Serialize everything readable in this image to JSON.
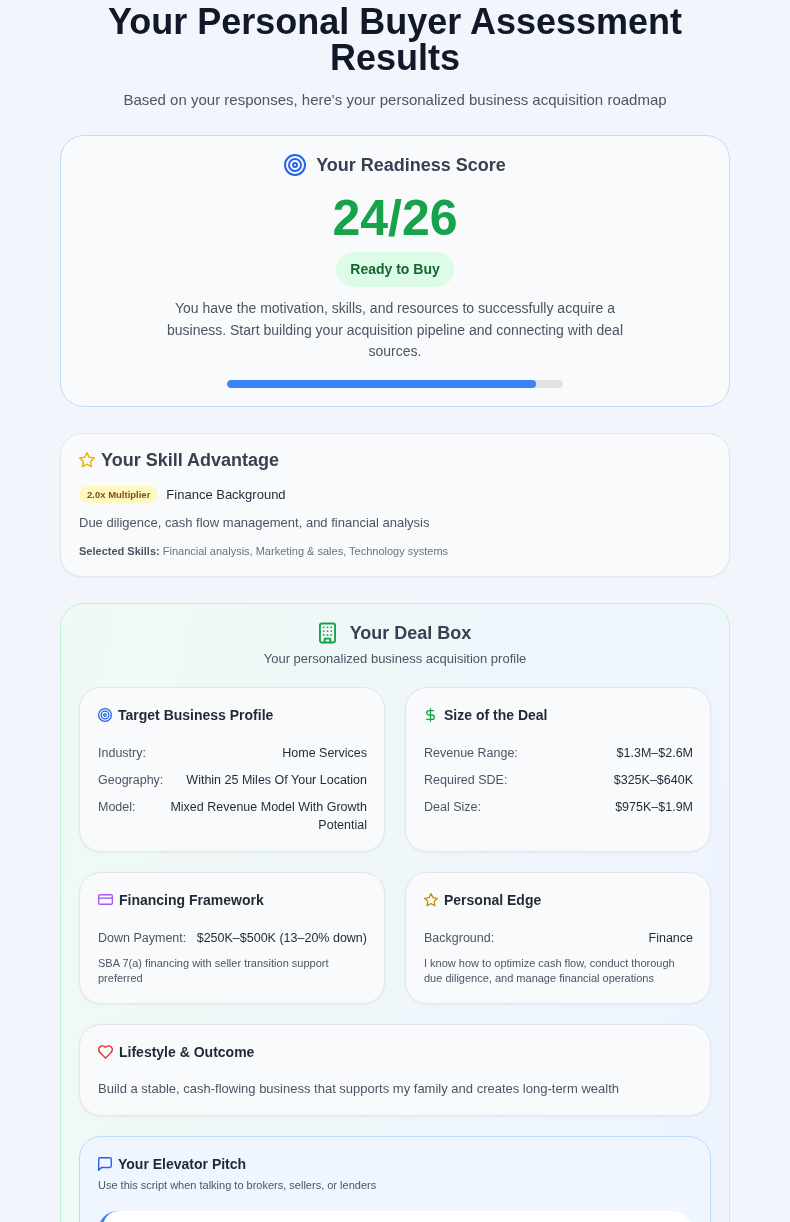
{
  "header": {
    "title": "Your Personal Buyer Assessment Results",
    "subtitle": "Based on your responses, here's your personalized business acquisition roadmap"
  },
  "readiness": {
    "title": "Your Readiness Score",
    "score": "24/26",
    "status": "Ready to Buy",
    "description": "You have the motivation, skills, and resources to successfully acquire a business. Start building your acquisition pipeline and connecting with deal sources.",
    "level": 0.92
  },
  "skill_advantage": {
    "title": "Your Skill Advantage",
    "multiplier": "2.0x Multiplier",
    "background": "Finance Background",
    "description": "Due diligence, cash flow management, and financial analysis",
    "selected_skills": "**Selected Skills:** Financial analysis, Marketing & sales, Technology systems"
  },
  "deal_box": {
    "title": "Your Deal Box",
    "subtitle": "Your personalized business acquisition profile",
    "target_profile": {
      "title": "Target Business Profile",
      "rows": [
        {
          "label": "Industry:",
          "value": "Home Services"
        },
        {
          "label": "Geography:",
          "value": "Within 25 Miles Of Your Location"
        },
        {
          "label": "Model:",
          "value": "Mixed Revenue Model With Growth Potential"
        }
      ]
    },
    "deal_size": {
      "title": "Size of the Deal",
      "rows": [
        {
          "label": "Revenue Range:",
          "value": "$1.3M–$2.6M"
        },
        {
          "label": "Required SDE:",
          "value": "$325K–$640K"
        },
        {
          "label": "Deal Size:",
          "value": "$975K–$1.9M"
        }
      ]
    },
    "financing": {
      "title": "Financing Framework",
      "rows": [
        {
          "label": "Down Payment:",
          "value": "$250K–$500K (13–20% down)"
        }
      ],
      "note": "SBA 7(a) financing with seller transition support preferred"
    },
    "personal_edge": {
      "title": "Personal Edge",
      "rows": [
        {
          "label": "Background:",
          "value": "Finance"
        }
      ],
      "note": "I know how to optimize cash flow, conduct thorough due diligence, and manage financial operations"
    },
    "lifestyle": {
      "title": "Lifestyle & Outcome",
      "text": "Build a stable, cash-flowing business that supports my family and creates long-term wealth"
    },
    "elevator_pitch": {
      "title": "Your Elevator Pitch",
      "subtitle": "Use this script when talking to brokers, sellers, or lenders"
    }
  }
}
